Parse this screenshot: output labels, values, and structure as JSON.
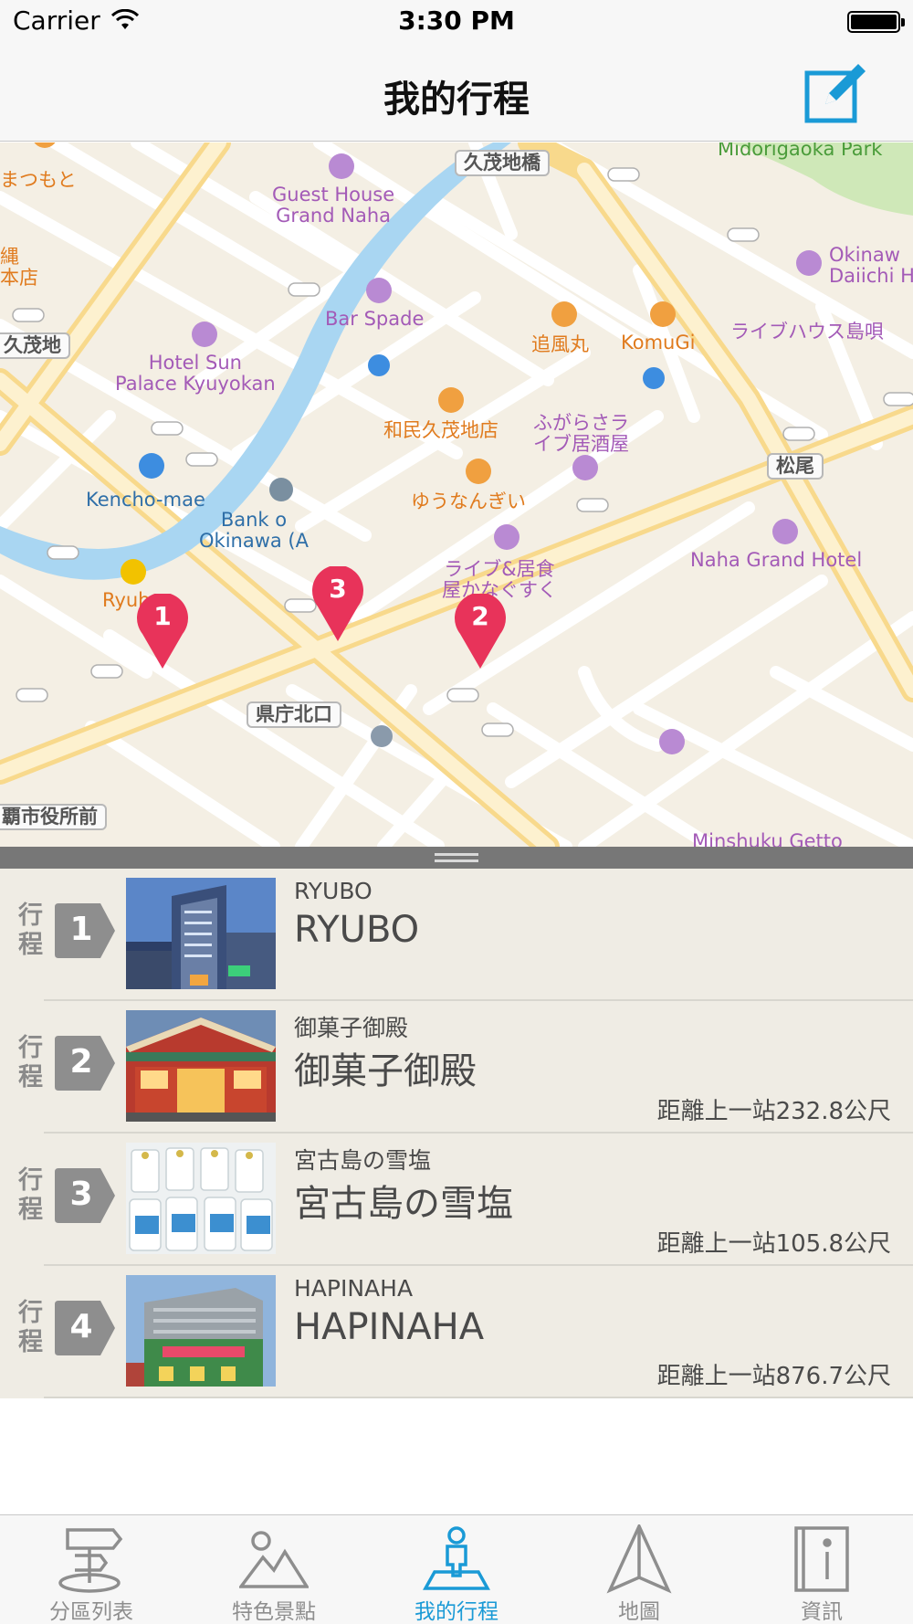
{
  "status_bar": {
    "carrier": "Carrier",
    "time": "3:30 PM"
  },
  "nav": {
    "title": "我的行程",
    "edit_icon": "compose-icon",
    "accent": "#1a9ad6"
  },
  "map": {
    "labels": {
      "matsumoto": "まつもと",
      "kumoji_bridge": "久茂地橋",
      "midorigaoka": "Midorigaoka Park",
      "guest_house": "Guest House\nGrand Naha",
      "nawa": "縄\n本店",
      "okinawa_daiichi": "Okinaw\nDaiichi H",
      "bar_spade": "Bar Spade",
      "kumoji_left": "久茂地",
      "hotel_sun": "Hotel Sun\nPalace Kyuyokan",
      "oikaze": "追風丸",
      "komugi": "KomuGi",
      "livehouse": "ライブハウス島唄",
      "watami": "和民久茂地店",
      "fugarasa": "ふがらさラ\nイブ居酒屋",
      "matsuo": "松尾",
      "kencho_mae": "Kencho-mae",
      "yuunangi": "ゆうなんぎい",
      "bank": "Bank o\nOkinawa (A",
      "naha_grand": "Naha Grand Hotel",
      "ryubo": "Ryubo",
      "live_izakaya": "ライブ&居食\n屋かなぐすく",
      "kencho_kitaguchi": "県庁北口",
      "shiyakusho": "覇市役所前",
      "minshuku": "Minshuku Getto"
    },
    "pins": [
      "1",
      "2",
      "3"
    ],
    "pin_color": "#e8335a"
  },
  "itinerary": [
    {
      "step_label": "行程",
      "step": "1",
      "subtitle": "RYUBO",
      "name": "RYUBO",
      "distance": ""
    },
    {
      "step_label": "行程",
      "step": "2",
      "subtitle": "御菓子御殿",
      "name": "御菓子御殿",
      "distance": "距離上一站232.8公尺"
    },
    {
      "step_label": "行程",
      "step": "3",
      "subtitle": "宮古島の雪塩",
      "name": "宮古島の雪塩",
      "distance": "距離上一站105.8公尺"
    },
    {
      "step_label": "行程",
      "step": "4",
      "subtitle": "HAPINAHA",
      "name": "HAPINAHA",
      "distance": "距離上一站876.7公尺"
    }
  ],
  "tabs": [
    {
      "label": "分區列表",
      "icon": "signpost-icon",
      "active": false
    },
    {
      "label": "特色景點",
      "icon": "landscape-icon",
      "active": false
    },
    {
      "label": "我的行程",
      "icon": "traveler-icon",
      "active": true
    },
    {
      "label": "地圖",
      "icon": "navigation-arrow-icon",
      "active": false
    },
    {
      "label": "資訊",
      "icon": "info-book-icon",
      "active": false
    }
  ]
}
